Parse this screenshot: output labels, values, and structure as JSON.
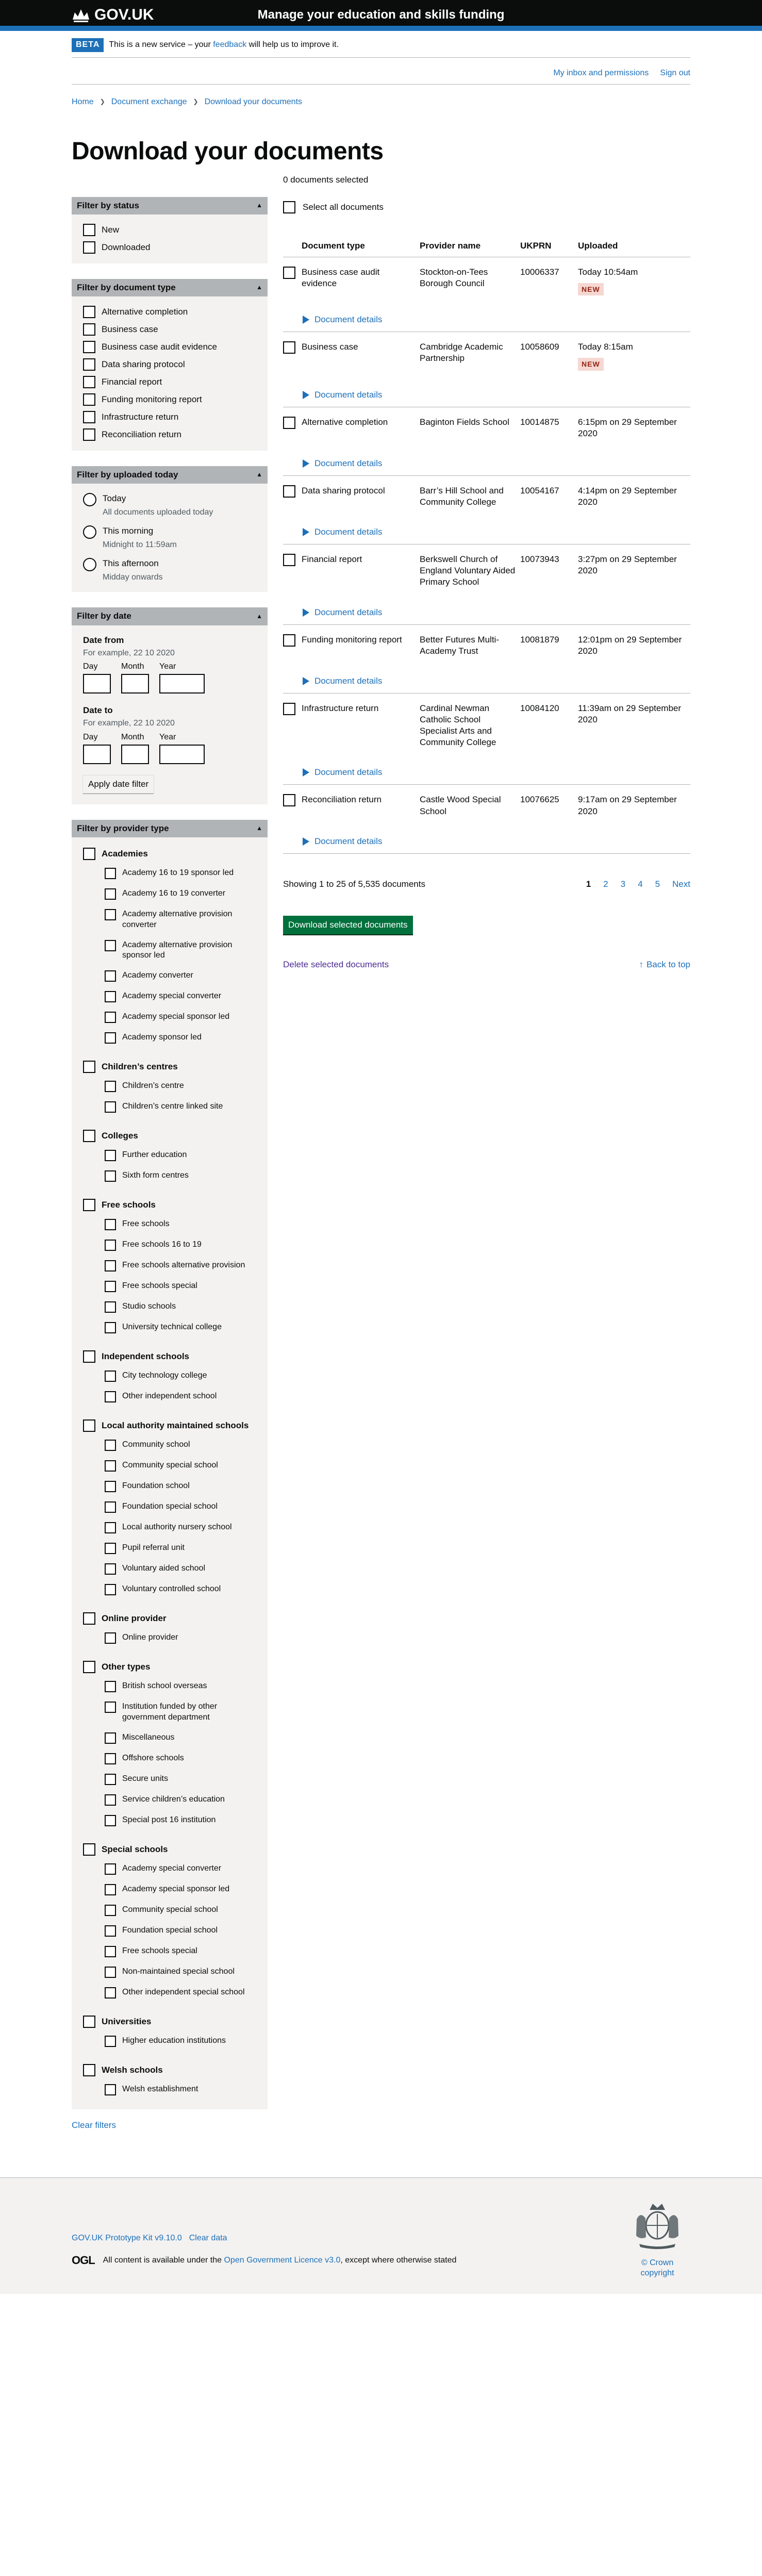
{
  "header": {
    "logo_text": "GOV.UK",
    "service_name": "Manage your education and skills funding"
  },
  "phase": {
    "tag": "BETA",
    "text_before": "This is a new service – your ",
    "link": "feedback",
    "text_after": " will help us to improve it."
  },
  "account": {
    "inbox": "My inbox and permissions",
    "signout": "Sign out"
  },
  "breadcrumbs": [
    "Home",
    "Document exchange",
    "Download your documents"
  ],
  "page_title": "Download your documents",
  "filters": {
    "status": {
      "title": "Filter by status",
      "options": [
        "New",
        "Downloaded"
      ]
    },
    "doctype": {
      "title": "Filter by document type",
      "options": [
        "Alternative completion",
        "Business case",
        "Business case audit evidence",
        "Data sharing protocol",
        "Financial report",
        "Funding monitoring report",
        "Infrastructure return",
        "Reconciliation return"
      ]
    },
    "uploaded": {
      "title": "Filter by uploaded today",
      "options": [
        {
          "label": "Today",
          "hint": "All documents uploaded today"
        },
        {
          "label": "This morning",
          "hint": "Midnight to 11:59am"
        },
        {
          "label": "This afternoon",
          "hint": "Midday onwards"
        }
      ]
    },
    "date": {
      "title": "Filter by date",
      "from_label": "Date from",
      "to_label": "Date to",
      "hint": "For example, 22 10 2020",
      "day": "Day",
      "month": "Month",
      "year": "Year",
      "apply": "Apply date filter"
    },
    "provider": {
      "title": "Filter by provider type",
      "groups": [
        {
          "name": "Academies",
          "items": [
            "Academy 16 to 19 sponsor led",
            "Academy 16 to 19 converter",
            "Academy alternative provision converter",
            "Academy alternative provision sponsor led",
            "Academy converter",
            "Academy special converter",
            "Academy special sponsor led",
            "Academy sponsor led"
          ]
        },
        {
          "name": "Children’s centres",
          "items": [
            "Children’s centre",
            "Children’s centre linked site"
          ]
        },
        {
          "name": "Colleges",
          "items": [
            "Further education",
            "Sixth form centres"
          ]
        },
        {
          "name": "Free schools",
          "items": [
            "Free schools",
            "Free schools 16 to 19",
            "Free schools alternative provision",
            "Free schools special",
            "Studio schools",
            "University technical college"
          ]
        },
        {
          "name": "Independent schools",
          "items": [
            "City technology college",
            "Other independent school"
          ]
        },
        {
          "name": "Local authority maintained schools",
          "items": [
            "Community school",
            "Community special school",
            "Foundation school",
            "Foundation special school",
            "Local authority nursery school",
            "Pupil referral unit",
            "Voluntary aided school",
            "Voluntary controlled school"
          ]
        },
        {
          "name": "Online provider",
          "items": [
            "Online provider"
          ]
        },
        {
          "name": "Other types",
          "items": [
            "British school overseas",
            "Institution funded by other government department",
            "Miscellaneous",
            "Offshore schools",
            "Secure units",
            "Service children’s education",
            "Special post 16 institution"
          ]
        },
        {
          "name": "Special schools",
          "items": [
            "Academy special converter",
            "Academy special sponsor led",
            "Community special school",
            "Foundation special school",
            "Free schools special",
            "Non-maintained special school",
            "Other independent special school"
          ]
        },
        {
          "name": "Universities",
          "items": [
            "Higher education institutions"
          ]
        },
        {
          "name": "Welsh schools",
          "items": [
            "Welsh establishment"
          ]
        }
      ]
    },
    "clear": "Clear filters"
  },
  "results": {
    "selected": "0 documents selected",
    "select_all": "Select all documents",
    "columns": [
      "Document type",
      "Provider name",
      "UKPRN",
      "Uploaded"
    ],
    "details_label": "Document details",
    "rows": [
      {
        "type": "Business case audit evidence",
        "provider": "Stockton-on-Tees Borough Council",
        "ukprn": "10006337",
        "uploaded": "Today 10:54am",
        "badge": "NEW"
      },
      {
        "type": "Business case",
        "provider": "Cambridge Academic Partnership",
        "ukprn": "10058609",
        "uploaded": "Today 8:15am",
        "badge": "NEW"
      },
      {
        "type": "Alternative completion",
        "provider": "Baginton Fields School",
        "ukprn": "10014875",
        "uploaded": "6:15pm on 29 September 2020",
        "badge": ""
      },
      {
        "type": "Data sharing protocol",
        "provider": "Barr’s Hill School and Community College",
        "ukprn": "10054167",
        "uploaded": "4:14pm on 29 September 2020",
        "badge": ""
      },
      {
        "type": "Financial report",
        "provider": "Berkswell Church of England Voluntary Aided Primary School",
        "ukprn": "10073943",
        "uploaded": "3:27pm on 29 September 2020",
        "badge": ""
      },
      {
        "type": "Funding monitoring report",
        "provider": "Better Futures Multi-Academy Trust",
        "ukprn": "10081879",
        "uploaded": "12:01pm on 29 September 2020",
        "badge": ""
      },
      {
        "type": "Infrastructure return",
        "provider": "Cardinal Newman Catholic School Specialist Arts and Community College",
        "ukprn": "10084120",
        "uploaded": "11:39am on 29 September 2020",
        "badge": ""
      },
      {
        "type": "Reconciliation return",
        "provider": "Castle Wood Special School",
        "ukprn": "10076625",
        "uploaded": "9:17am on 29 September 2020",
        "badge": ""
      }
    ],
    "showing": "Showing 1 to 25 of 5,535 documents",
    "pages": [
      "1",
      "2",
      "3",
      "4",
      "5"
    ],
    "next": "Next",
    "download": "Download selected documents",
    "delete": "Delete selected documents",
    "back_to_top": "Back to top"
  },
  "footer": {
    "prototype_kit": "GOV.UK Prototype Kit v9.10.0",
    "clear_data": "Clear data",
    "ogl": "OGL",
    "licence_before": "All content is available under the ",
    "licence_link": "Open Government Licence v3.0",
    "licence_after": ", except where otherwise stated",
    "copyright": "© Crown copyright"
  }
}
